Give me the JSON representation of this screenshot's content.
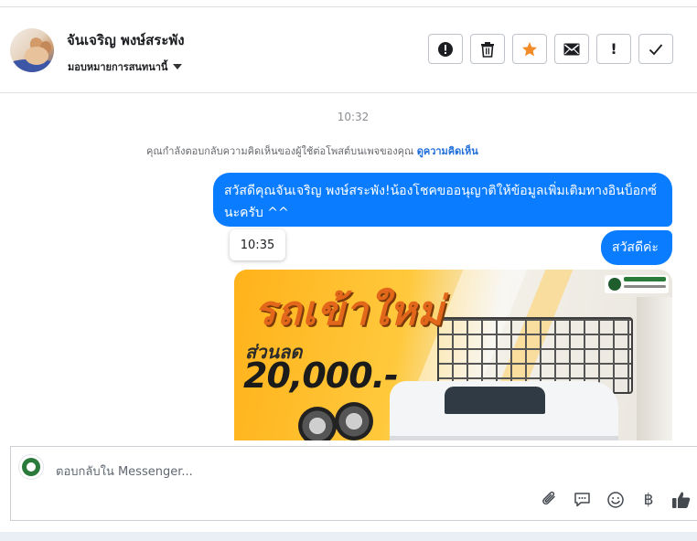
{
  "header": {
    "user_name": "จันเจริญ พงษ์สระพัง",
    "assign_label": "มอบหมายการสนทนานี้",
    "actions": [
      {
        "name": "report-spam",
        "icon": "exclamation-circle-icon"
      },
      {
        "name": "delete",
        "icon": "trash-icon"
      },
      {
        "name": "follow-up",
        "icon": "star-icon",
        "color": "#f28c28"
      },
      {
        "name": "mark-unread",
        "icon": "envelope-icon"
      },
      {
        "name": "mark-spam",
        "icon": "exclamation-icon",
        "label": "!"
      },
      {
        "name": "mark-done",
        "icon": "check-icon"
      }
    ]
  },
  "thread": {
    "timestamp_top": "10:32",
    "notice_text": "คุณกำลังตอบกลับความคิดเห็นของผู้ใช้ต่อโพสต์บนเพจของคุณ",
    "notice_link": "ดูความคิดเห็น",
    "messages": [
      {
        "side": "right",
        "text": "สวัสดีคุณจันเจริญ พงษ์สระพัง!น้องโชคขออนุญาติให้ข้อมูลเพิ่มเติมทางอินบ็อกซ์นะครับ ^^"
      },
      {
        "side": "right",
        "text": "สวัสดีค่ะ"
      }
    ],
    "timestamp_chip": "10:35",
    "promo_image": {
      "headline": "รถเข้าใหม่",
      "discount_label": "ส่วนลด",
      "discount_amount": "20,000.-"
    }
  },
  "composer": {
    "placeholder": "ตอบกลับใน Messenger...",
    "tools": [
      "paperclip-icon",
      "speech-bubbles-icon",
      "emoji-icon",
      "baht-icon",
      "thumbs-up-icon"
    ],
    "baht_symbol": "฿"
  },
  "colors": {
    "bubble": "#0a7cff",
    "link": "#216fdb",
    "star": "#f28c28"
  }
}
